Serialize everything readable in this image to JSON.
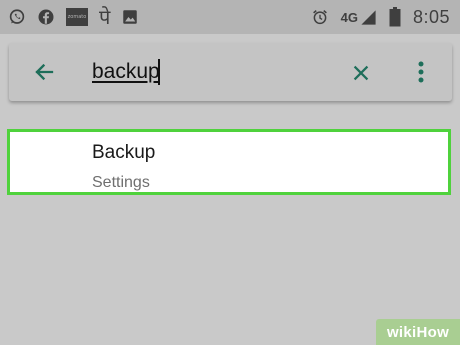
{
  "status_bar": {
    "left_icons": [
      "whatsapp-icon",
      "facebook-icon",
      "zomato-icon",
      "paytm-icon",
      "gallery-icon"
    ],
    "zomato_text": "zomato",
    "paytm_glyph": "पे",
    "right_icons": [
      "alarm-icon",
      "signal-icon",
      "battery-icon"
    ],
    "network": "4G",
    "time": "8:05"
  },
  "search": {
    "query": "backup",
    "back_icon": "arrow-back-icon",
    "clear_icon": "close-icon",
    "menu_icon": "more-vert-icon",
    "accent_color": "#1e6e5a"
  },
  "results": [
    {
      "title": "Backup",
      "subtitle": "Settings"
    }
  ],
  "highlight_color": "#4fd23c",
  "watermark": "wikiHow"
}
